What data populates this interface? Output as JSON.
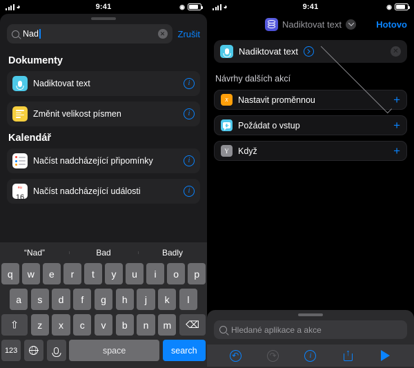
{
  "status_bar": {
    "time": "9:41"
  },
  "left_panel": {
    "search": {
      "value": "Nad",
      "cancel_label": "Zrušit",
      "clear_icon": "clear-icon",
      "search_icon": "search-icon"
    },
    "sections": [
      {
        "title": "Dokumenty",
        "items": [
          {
            "label": "Nadiktovat text",
            "icon": "microphone-icon",
            "icon_color": "#4dc9e8",
            "info_icon": "info-icon"
          },
          {
            "label": "Změnit velikost písmen",
            "icon": "text-lines-icon",
            "icon_color": "#f7cf3e",
            "info_icon": "info-icon"
          }
        ]
      },
      {
        "title": "Kalendář",
        "items": [
          {
            "label": "Načíst nadcházející připomínky",
            "icon": "reminders-icon",
            "icon_color": "#ffffff",
            "info_icon": "info-icon"
          },
          {
            "label": "Načíst nadcházející události",
            "icon": "calendar-icon",
            "icon_color": "#ffffff",
            "info_icon": "info-icon",
            "calendar_month": "ŘÍJ",
            "calendar_day": "16"
          }
        ]
      }
    ],
    "keyboard": {
      "suggestions": [
        "“Nad”",
        "Bad",
        "Badly"
      ],
      "row1": [
        "q",
        "w",
        "e",
        "r",
        "t",
        "y",
        "u",
        "i",
        "o",
        "p"
      ],
      "row2": [
        "a",
        "s",
        "d",
        "f",
        "g",
        "h",
        "j",
        "k",
        "l"
      ],
      "row3": [
        "z",
        "x",
        "c",
        "v",
        "b",
        "n",
        "m"
      ],
      "shift_icon": "shift-icon",
      "delete_icon": "delete-icon",
      "numbers_label": "123",
      "globe_icon": "globe-icon",
      "dictation_icon": "microphone-icon",
      "space_label": "space",
      "return_label": "search"
    }
  },
  "right_panel": {
    "nav": {
      "title": "Nadiktovat text",
      "app_icon": "shortcuts-icon",
      "chevron_icon": "chevron-down-icon",
      "done_label": "Hotovo"
    },
    "action_card": {
      "title": "Nadiktovat text",
      "icon": "microphone-icon",
      "icon_color": "#4dc9e8",
      "open_icon": "chevron-right-circle-icon",
      "remove_icon": "remove-icon"
    },
    "suggestions_header": {
      "label": "Návrhy dalších akcí",
      "collapse_icon": "chevron-down-icon"
    },
    "suggestions": [
      {
        "label": "Nastavit proměnnou",
        "icon": "variable-x-icon",
        "icon_color": "#ff9f0a",
        "glyph": "x",
        "add_icon": "plus-icon"
      },
      {
        "label": "Požádat o vstup",
        "icon": "ask-input-icon",
        "icon_color": "#50c8ec",
        "add_icon": "plus-icon"
      },
      {
        "label": "Když",
        "icon": "conditional-y-icon",
        "icon_color": "#8e8e93",
        "glyph": "Y",
        "add_icon": "plus-icon"
      }
    ],
    "bottom": {
      "search_placeholder": "Hledané aplikace a akce",
      "search_icon": "search-icon",
      "toolbar": [
        {
          "name": "undo-button",
          "icon": "undo-icon",
          "enabled": true
        },
        {
          "name": "redo-button",
          "icon": "redo-icon",
          "enabled": false
        },
        {
          "name": "info-button",
          "icon": "info-icon",
          "enabled": true
        },
        {
          "name": "share-button",
          "icon": "share-icon",
          "enabled": true
        },
        {
          "name": "play-button",
          "icon": "play-icon",
          "enabled": true
        }
      ]
    }
  }
}
